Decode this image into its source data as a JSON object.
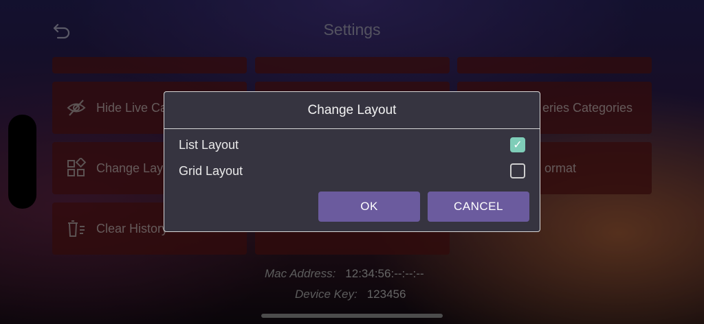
{
  "header": {
    "title": "Settings",
    "back_icon": "undo-arrow-icon"
  },
  "tiles": [
    {
      "label": "Hide Live Ca",
      "icon": "eye-off-icon"
    },
    {
      "label": "Change Lay",
      "icon": "grid-shapes-icon"
    },
    {
      "label": "Clear History",
      "icon": "trash-list-icon"
    },
    {
      "label": "eries Categories"
    },
    {
      "label": "ormat"
    }
  ],
  "device_info": {
    "mac_label": "Mac Address:",
    "mac_value": "12:34:56:--:--:--",
    "key_label": "Device Key:",
    "key_value": "123456"
  },
  "dialog": {
    "title": "Change Layout",
    "options": [
      {
        "label": "List Layout",
        "checked": true
      },
      {
        "label": "Grid Layout",
        "checked": false
      }
    ],
    "ok_label": "OK",
    "cancel_label": "CANCEL"
  },
  "colors": {
    "accent_button": "#6b5b9e",
    "checkbox_checked": "#7fcdb8",
    "tile_bg": "#5a1416"
  }
}
